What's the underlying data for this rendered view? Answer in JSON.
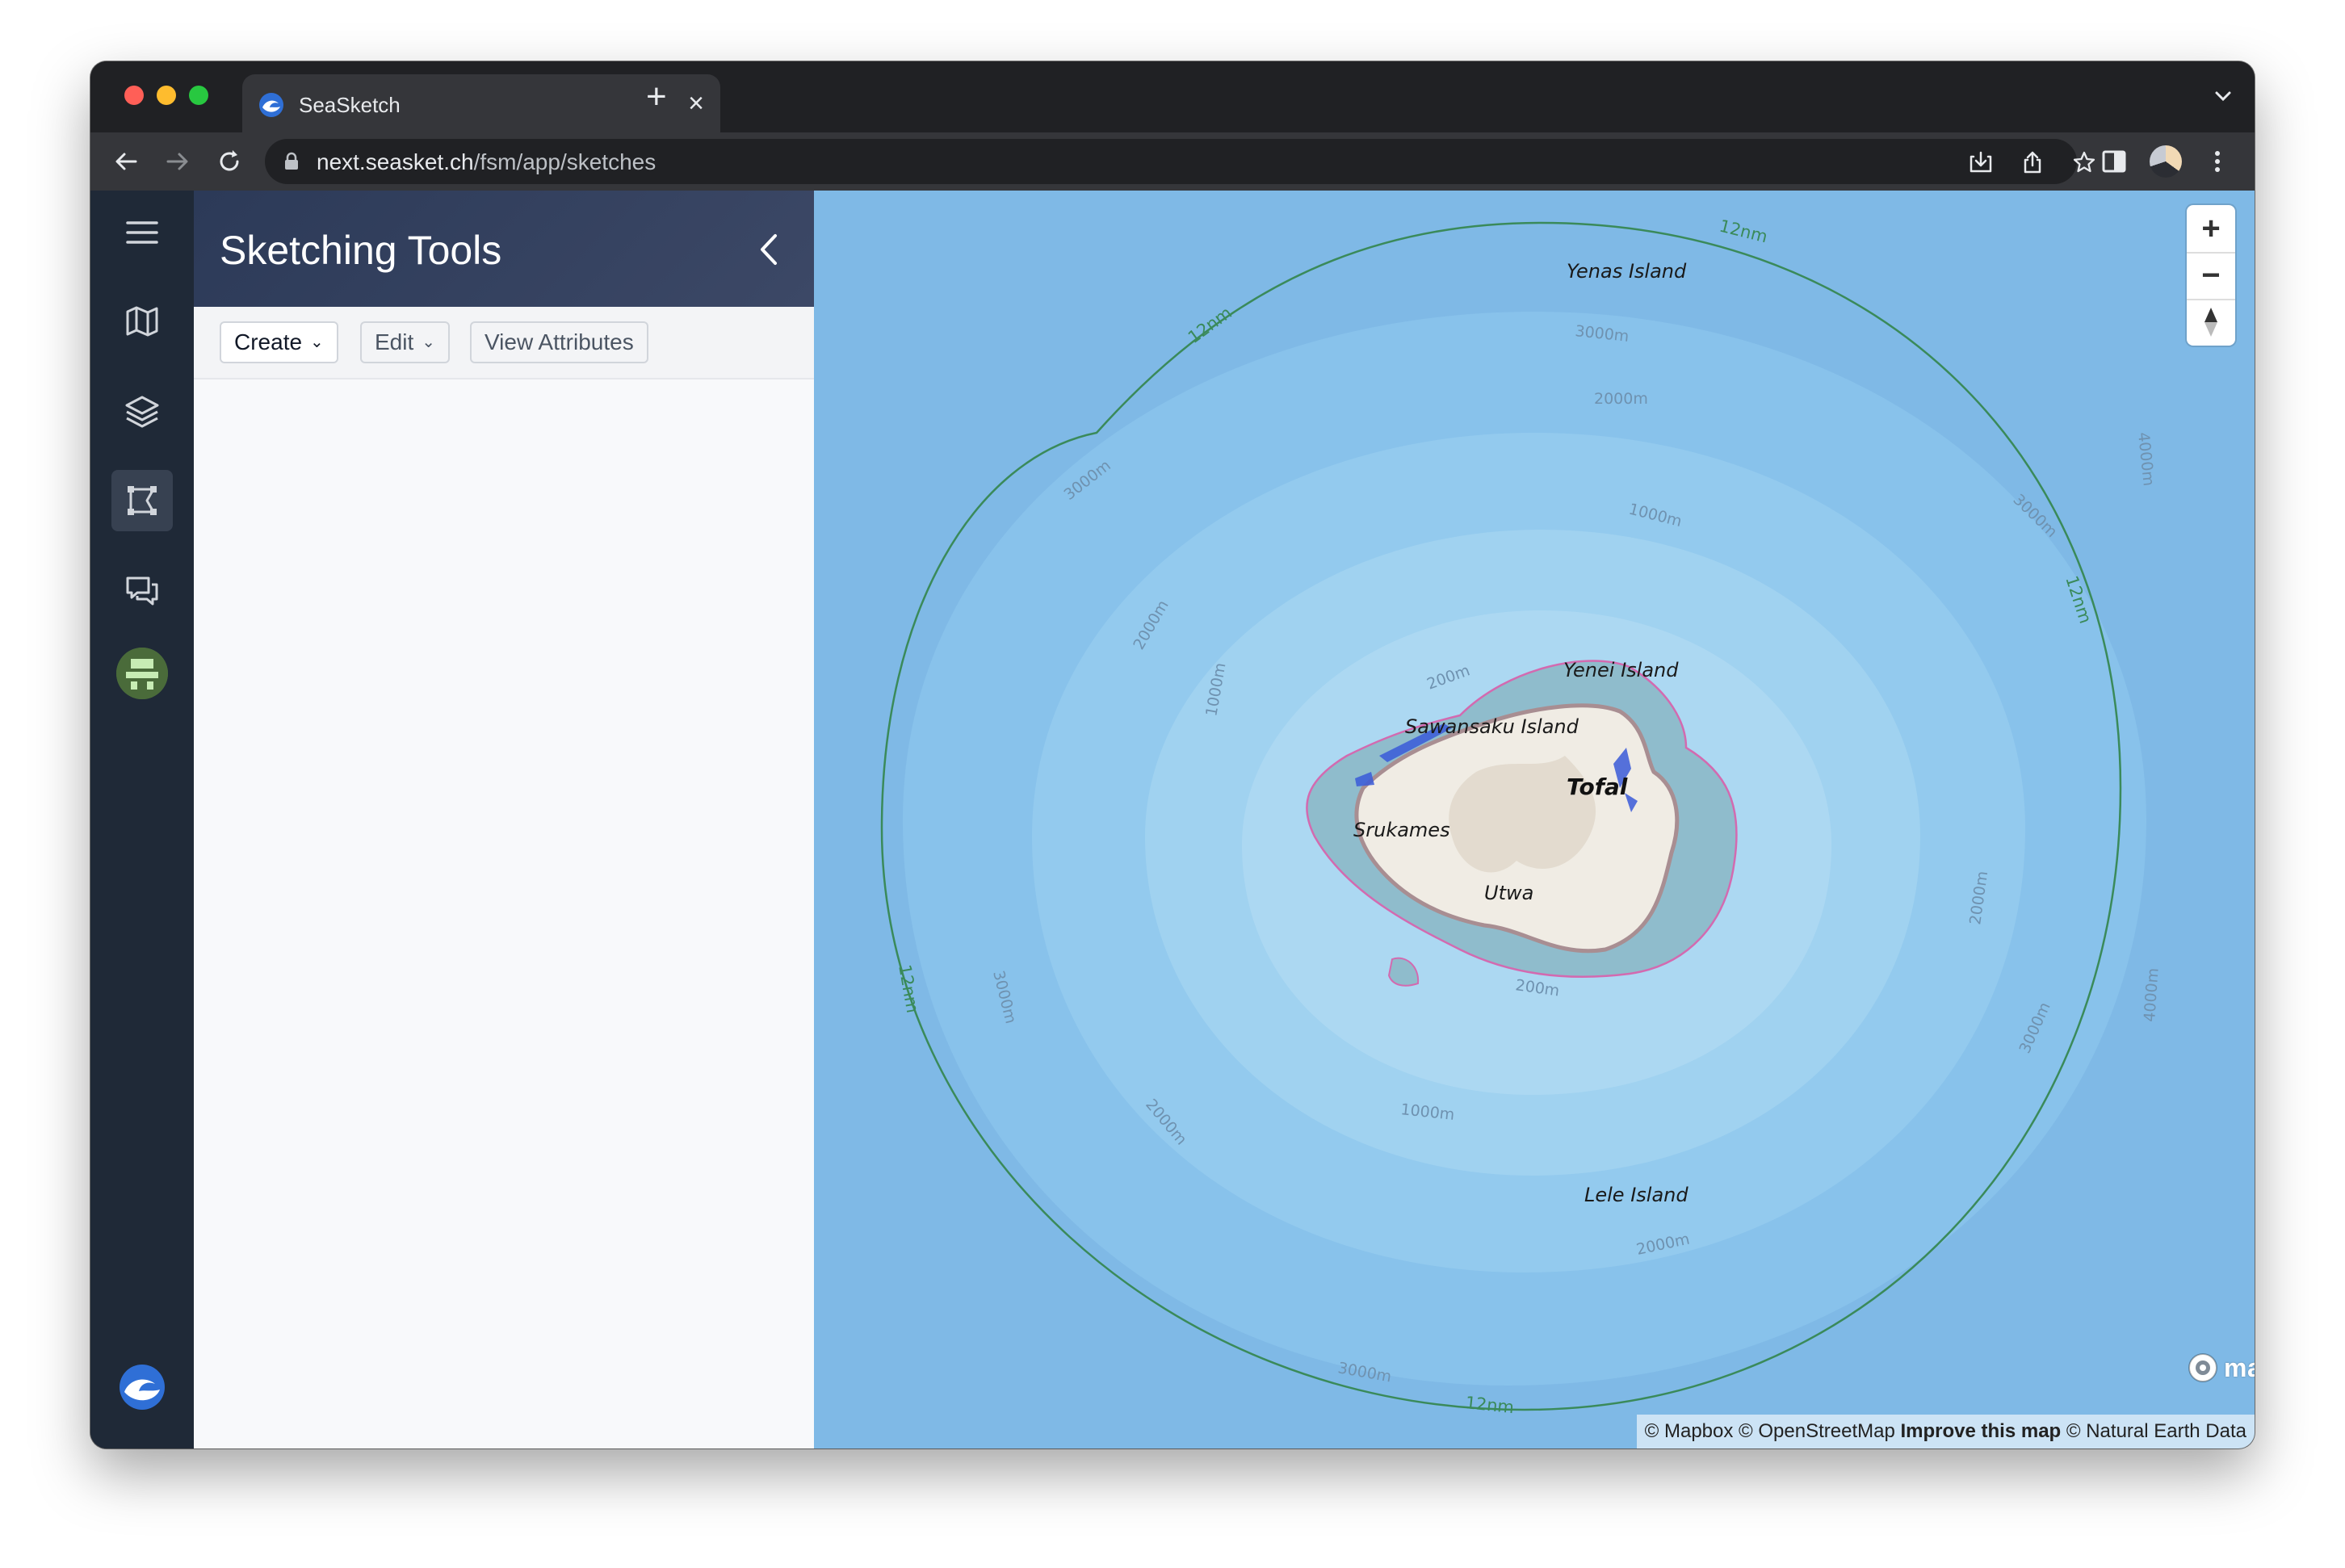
{
  "browser": {
    "tab_title": "SeaSketch",
    "url_host": "next.seasket.ch",
    "url_path": "/fsm/app/sketches"
  },
  "sidebar": {
    "items": [
      {
        "name": "menu",
        "icon": "hamburger-menu-icon"
      },
      {
        "name": "maps",
        "icon": "map-icon"
      },
      {
        "name": "layers",
        "icon": "layers-icon"
      },
      {
        "name": "sketching",
        "icon": "sketch-polygon-icon",
        "active": true
      },
      {
        "name": "forums",
        "icon": "chat-icon"
      },
      {
        "name": "profile",
        "icon": "user-avatar-icon"
      }
    ],
    "footer_icon": "seasketch-logo-icon"
  },
  "panel": {
    "title": "Sketching Tools",
    "toolbar": {
      "create_label": "Create",
      "edit_label": "Edit",
      "view_attributes_label": "View Attributes"
    }
  },
  "map": {
    "places": {
      "yenas": "Yenas Island",
      "yenei": "Yenei Island",
      "sawansaku": "Sawansaku Island",
      "tofal": "Tofal",
      "srukames": "Srukames",
      "utwa": "Utwa",
      "lele": "Lele Island"
    },
    "depth_labels": {
      "d200": "200m",
      "d1000": "1000m",
      "d2000": "2000m",
      "d3000": "3000m",
      "d4000": "4000m"
    },
    "boundary_label": "12nm",
    "zoom": {
      "in": "+",
      "out": "−"
    },
    "logo_text": "mapbox",
    "attribution": {
      "prefix": "© Mapbox © OpenStreetMap",
      "improve": "Improve this map",
      "suffix": "© Natural Earth Data"
    }
  },
  "colors": {
    "sidebar_bg": "#1f2937",
    "panel_header": "#2c3a58",
    "ocean_deep": "#7fb9e6",
    "ocean_shallow": "#b6dcf0",
    "boundary_line": "#3a8a5a",
    "reef_outline": "#d36ab0",
    "land": "#f0ece4"
  }
}
